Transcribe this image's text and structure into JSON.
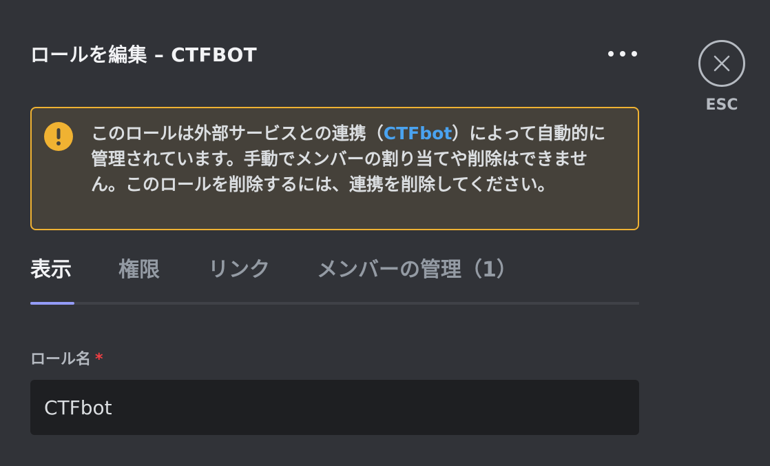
{
  "header": {
    "title": "ロールを編集 – CTFBOT",
    "more_icon": "more-horizontal-icon",
    "close_icon": "close-icon",
    "close_label": "ESC"
  },
  "warning": {
    "icon": "warning-icon",
    "text_before": "このロールは外部サービスとの連携（",
    "link": "CTFbot",
    "text_after": "）によって自動的に管理されています。手動でメンバーの割り当てや削除はできません。このロールを削除するには、連携を削除してください。",
    "colors": {
      "border": "#f0b232",
      "link": "#4aa3f0"
    }
  },
  "tabs": [
    {
      "label": "表示",
      "active": true
    },
    {
      "label": "権限",
      "active": false
    },
    {
      "label": "リンク",
      "active": false
    },
    {
      "label": "メンバーの管理（1）",
      "active": false
    }
  ],
  "form": {
    "role_name_label": "ロール名",
    "required_mark": "*",
    "role_name_value": "CTFbot"
  },
  "colors": {
    "background": "#313338",
    "tab_accent": "#949cf7"
  }
}
